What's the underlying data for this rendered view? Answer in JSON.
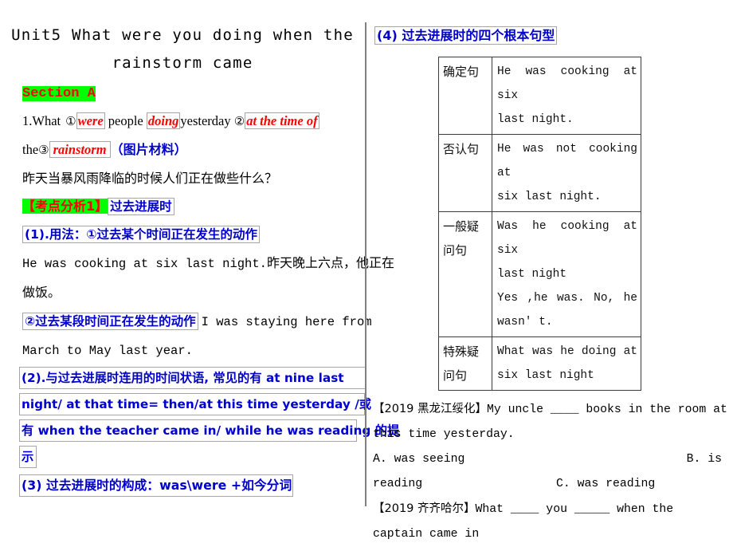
{
  "document": {
    "title_line1": "Unit5 What were you doing when the",
    "title_line2": "rainstorm came",
    "section_label": "Section A"
  },
  "left_column": {
    "q1": {
      "prefix": "1.What",
      "num1": "①",
      "blank1": "were",
      "mid1": "people",
      "blank2": "doing",
      "mid2": "yesterday",
      "num2": "②",
      "blank3": "at the time of",
      "line2_prefix": "the",
      "num3": "③",
      "blank4": "rainstorm",
      "line2_suffix": "（图片材料）",
      "translation": "昨天当暴风雨降临的时候人们正在做些什么？"
    },
    "analysis": {
      "tag": "【考点分析1】",
      "topic": "过去进展时"
    },
    "point1": {
      "heading": "(1).用法：①过去某个时间正在发生的动作",
      "example_en": "He was cooking at six last night.",
      "example_cn": "昨天晚上六点，他正在",
      "example_cn2": "做饭。",
      "sub_heading": "②过去某段时间正在发生的动作",
      "sub_example_1": "I was staying here from",
      "sub_example_2": "March to May last year."
    },
    "point2": {
      "line1": "(2).与过去进展时连用的时间状语, 常见的有 at nine last",
      "line2": "night/  at that time= then/at this time yesterday /或",
      "line3": "有 when the teacher came in/  while he was reading 的提",
      "line4": "示"
    },
    "point3": {
      "line1": "(3) 过去进展时的构成：was\\were +如今分词"
    }
  },
  "right_column": {
    "point4_heading": "(4) 过去进展时的四个根本句型",
    "table": {
      "rows": [
        {
          "label": "确定句",
          "lines": [
            "He was cooking at six",
            "last night."
          ]
        },
        {
          "label": "否认句",
          "lines": [
            "He was not cooking at",
            "six last night."
          ]
        },
        {
          "label": "一般疑\n问句",
          "label_l1": "一般疑",
          "label_l2": "问句",
          "lines": [
            "Was he cooking at six",
            "last night",
            "  Yes ,he was.  No, he",
            "wasn' t."
          ]
        },
        {
          "label_l1": "特殊疑",
          "label_l2": "问句",
          "lines": [
            "What was he doing at",
            "six last night"
          ]
        }
      ]
    },
    "exercise1": {
      "source": "【2019 黑龙江绥化】",
      "stem_part1": "My uncle ____ books in the room at",
      "stem_part2": "this time yesterday.",
      "optionA": "A.  was  seeing",
      "optionB": "B.  is",
      "optionB_cont": "reading",
      "optionC": "C. was reading"
    },
    "exercise2": {
      "source": "【2019 齐齐哈尔】",
      "stem_part1": "What    ____ you    _____ when the",
      "stem_part2": "captain came in"
    }
  },
  "colors": {
    "highlight_green": "#00ff00",
    "red_text": "#ff0000",
    "blue_text": "#0000cd",
    "box_border": "#a6a6a6",
    "table_border": "#3c3c3c",
    "divider": "#808080"
  }
}
